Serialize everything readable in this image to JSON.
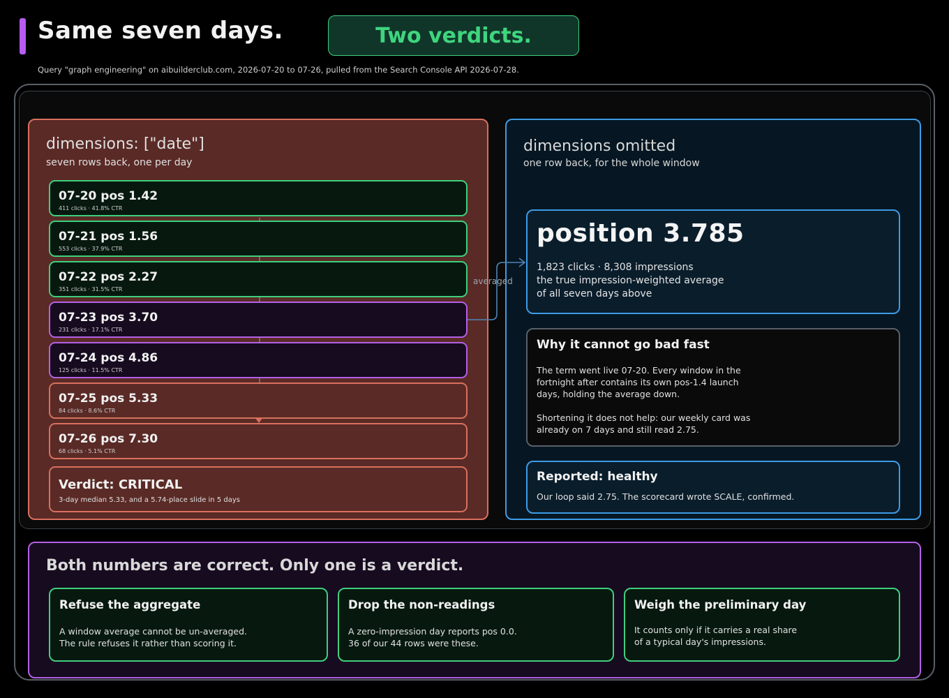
{
  "header": {
    "title": "Same seven days.",
    "badge": "Two verdicts.",
    "subtitle": "Query \"graph engineering\" on aibuilderclub.com, 2026-07-20 to 07-26, pulled from the Search Console API 2026-07-28."
  },
  "left": {
    "heading": "dimensions: [\"date\"]",
    "subheading": "seven rows back, one per day",
    "rows": [
      {
        "main": "07-20 pos 1.42",
        "meta": "411 clicks · 41.8% CTR",
        "status": "green"
      },
      {
        "main": "07-21 pos 1.56",
        "meta": "553 clicks · 37.9% CTR",
        "status": "green"
      },
      {
        "main": "07-22 pos 2.27",
        "meta": "351 clicks · 31.5% CTR",
        "status": "green"
      },
      {
        "main": "07-23 pos 3.70",
        "meta": "231 clicks · 17.1% CTR",
        "status": "purple"
      },
      {
        "main": "07-24 pos 4.86",
        "meta": "125 clicks · 11.5% CTR",
        "status": "purple"
      },
      {
        "main": "07-25 pos 5.33",
        "meta": "84 clicks · 8.6% CTR",
        "status": "red"
      },
      {
        "main": "07-26 pos 7.30",
        "meta": "68 clicks · 5.1% CTR",
        "status": "red"
      }
    ],
    "verdict": {
      "main": "Verdict: CRITICAL",
      "meta": "3-day median 5.33, and a 5.74-place slide in 5 days"
    }
  },
  "arrow_label": "averaged",
  "right": {
    "heading": "dimensions omitted",
    "subheading": "one row back, for the whole window",
    "position": {
      "value": "position 3.785",
      "line1": "1,823 clicks · 8,308 impressions",
      "line2": "the true impression-weighted average",
      "line3": "of all seven days above"
    },
    "why": {
      "title": "Why it cannot go bad fast",
      "p1_l1": "The term went live 07-20. Every window in the",
      "p1_l2": "fortnight after contains its own pos-1.4 launch",
      "p1_l3": "days, holding the average down.",
      "p2_l1": "Shortening it does not help: our weekly card was",
      "p2_l2": "already on 7 days and still read 2.75."
    },
    "reported": {
      "title": "Reported: healthy",
      "body": "Our loop said 2.75. The scorecard wrote SCALE, confirmed."
    }
  },
  "bottom": {
    "title": "Both numbers are correct. Only one is a verdict.",
    "cards": [
      {
        "title": "Refuse the aggregate",
        "l1": "A window average cannot be un-averaged.",
        "l2": "The rule refuses it rather than scoring it."
      },
      {
        "title": "Drop the non-readings",
        "l1": "A zero-impression day reports pos 0.0.",
        "l2": "36 of our 44 rows were these."
      },
      {
        "title": "Weigh the preliminary day",
        "l1": "It counts only if it carries a real share",
        "l2": "of a typical day's impressions."
      }
    ]
  },
  "colors": {
    "green": "#3fcf7d",
    "purple": "#b461e6",
    "red": "#d8705e",
    "blue": "#3d9be6"
  }
}
